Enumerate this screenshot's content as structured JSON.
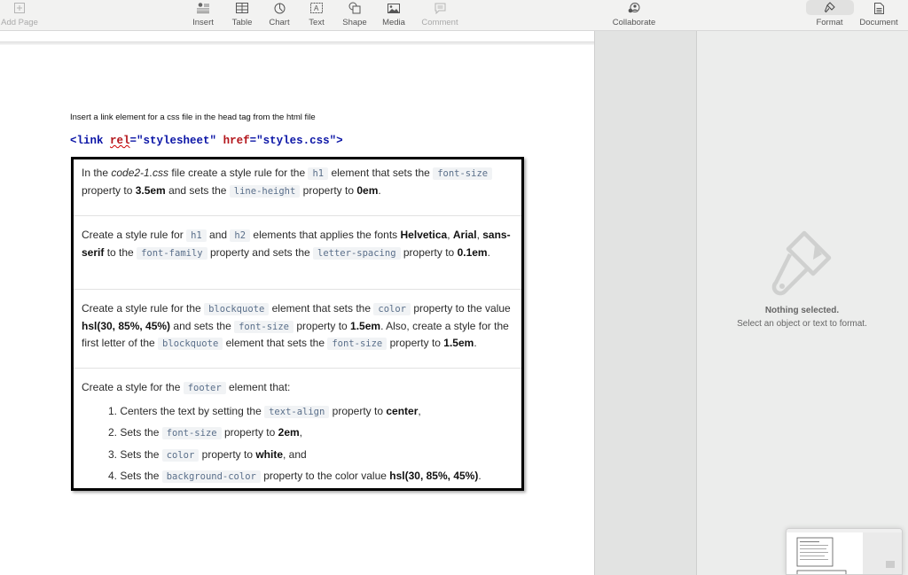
{
  "toolbar": {
    "add_page": "Add Page",
    "insert": "Insert",
    "table": "Table",
    "chart": "Chart",
    "text": "Text",
    "shape": "Shape",
    "media": "Media",
    "comment": "Comment",
    "collaborate": "Collaborate",
    "format": "Format",
    "document": "Document"
  },
  "document": {
    "heading": "Insert a link element for a css file in the head tag from the html file",
    "code": {
      "open": "<link ",
      "attr1": "rel",
      "eq1": "=",
      "val1": "\"stylesheet\"",
      "space": " ",
      "attr2": "href",
      "eq2": "=",
      "val2": "\"styles.css\"",
      "close": ">"
    },
    "tasks": {
      "t1": {
        "p1": "In the ",
        "em": "code2-1.css",
        "p2": " file create a style rule for the ",
        "c1": "h1",
        "p3": " element that sets the ",
        "c2": "font-size",
        "p4": " property to ",
        "b1": "3.5em",
        "p5": " and sets the ",
        "c3": "line-height",
        "p6": " property to ",
        "b2": "0em",
        "p7": "."
      },
      "t2": {
        "p1": "Create a style rule for ",
        "c1": "h1",
        "p2": " and ",
        "c2": "h2",
        "p3": " elements that applies the fonts ",
        "b1": "Helvetica",
        "p4": ", ",
        "b2": "Arial",
        "p5": ", ",
        "b3": "sans-serif",
        "p6": " to the ",
        "c3": "font-family",
        "p7": " property and sets the ",
        "c4": "letter-spacing",
        "p8": " property to ",
        "b4": "0.1em",
        "p9": "."
      },
      "t3": {
        "p1": "Create a style rule for the ",
        "c1": "blockquote",
        "p2": " element that sets the ",
        "c2": "color",
        "p3": " property to the value ",
        "b1": "hsl(30, 85%, 45%)",
        "p4": " and sets the ",
        "c3": "font-size",
        "p5": " property to ",
        "b2": "1.5em",
        "p6": ". Also, create a style for the first letter of the ",
        "c4": "blockquote",
        "p7": " element that sets the ",
        "c5": "font-size",
        "p8": " property to ",
        "b3": "1.5em",
        "p9": "."
      },
      "t4": {
        "intro1": "Create a style for the ",
        "intro_code": "footer",
        "intro2": " element that:",
        "items": [
          {
            "n": "1. Centers the text by setting the ",
            "code": "text-align",
            "mid": " property to ",
            "bold": "center",
            "end": ","
          },
          {
            "n": "2. Sets the ",
            "code": "font-size",
            "mid": " property to ",
            "bold": "2em",
            "end": ","
          },
          {
            "n": "3. Sets the ",
            "code": "color",
            "mid": " property to ",
            "bold": "white",
            "end": ", and"
          },
          {
            "n": "4. Sets the ",
            "code": "background-color",
            "mid": " property to the color value ",
            "bold": "hsl(30, 85%, 45%)",
            "end": "."
          }
        ]
      }
    }
  },
  "inspector": {
    "empty_title": "Nothing selected.",
    "empty_subtitle": "Select an object or text to format."
  }
}
